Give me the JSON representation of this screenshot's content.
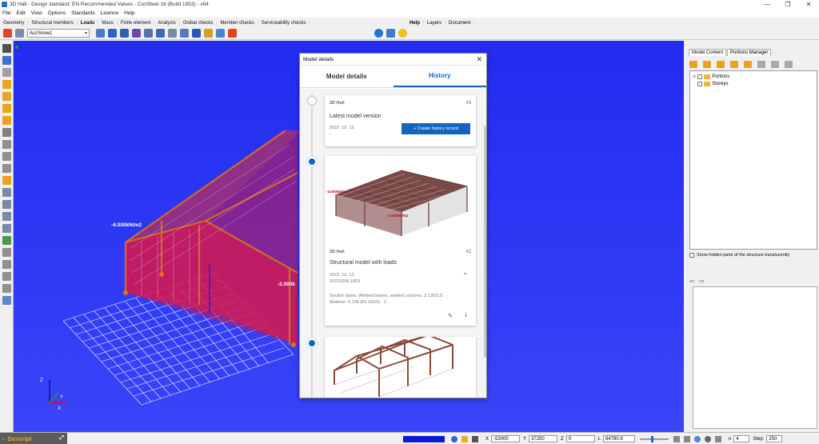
{
  "window": {
    "title": "3D Hall - Design standard: EN Recommended Values - ConSteel 16 (Build 1853) - x64",
    "minimize": "—",
    "maximize": "❐",
    "close": "✕"
  },
  "menu": [
    "File",
    "Edit",
    "View",
    "Options",
    "Standards",
    "Licence",
    "Help"
  ],
  "ribbon_tabs": [
    "Geometry",
    "Structural members",
    "Loads",
    "Mass",
    "Finite element",
    "Analysis",
    "Global checks",
    "Member checks",
    "Serviceability checks"
  ],
  "ribbon_active": "Loads",
  "ribbon_tabs_right": [
    "Help",
    "Layers",
    "Document"
  ],
  "toolbar": {
    "load_case": "AccSnow1"
  },
  "viewport": {
    "load_labels": [
      "-4.000kN/m2",
      "-2.000k"
    ],
    "axis": {
      "x": "X",
      "y": "Y",
      "z": "Z"
    },
    "accent_color": "#e00040"
  },
  "right_panel": {
    "tabs": [
      "Model Content",
      "Portions Manager"
    ],
    "tree": [
      "Portions",
      "Storeys"
    ],
    "checkbox_label": "Show hidden parts of the structure translucently"
  },
  "status": {
    "descript": "Descript",
    "x_label": "X",
    "x_value": "-53000",
    "y_label": "Y",
    "y_value": "37250",
    "z_label": "Z",
    "z_value": "0",
    "l_label": "L",
    "l_value": "64780.9",
    "n_label": "n",
    "n_value": "4",
    "step_label": "Step:",
    "step_value": "250"
  },
  "modal": {
    "title": "Model details",
    "tabs": [
      "Model details",
      "History"
    ],
    "active_tab": "History",
    "cards": [
      {
        "project": "3D Hall",
        "number": "#3",
        "title": "Latest model version",
        "date": "2022. 10. 12.",
        "sub": "-",
        "button": "+ Create history record"
      },
      {
        "project": "3D Hall",
        "number": "#2",
        "title": "Structural model with loads",
        "date": "2022. 10. 12.",
        "sub": "20221006.1853",
        "details": [
          "Section types: Welded beams, welded columns, Z 120/2.5",
          "Material: S 235 EN 10025 - 2"
        ],
        "thumb_labels": [
          "-4.000kN/m2",
          "-2.000kN/m2"
        ]
      }
    ]
  }
}
